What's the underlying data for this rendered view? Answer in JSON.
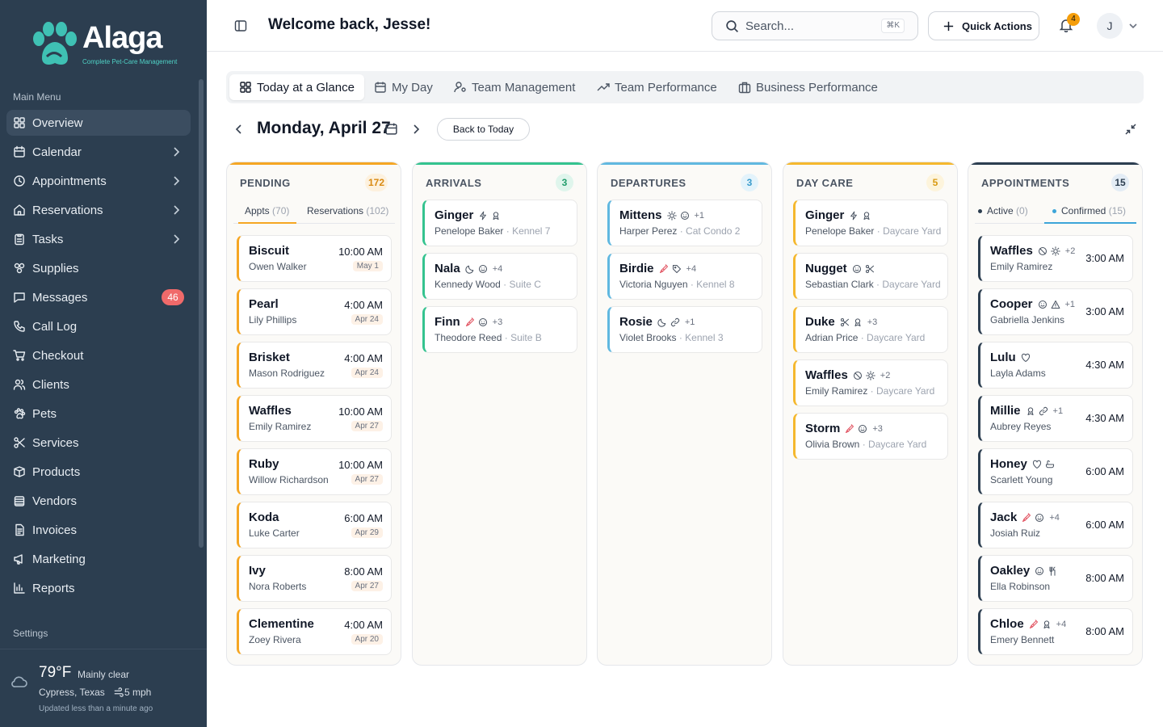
{
  "app": {
    "brand": "Alaga",
    "tagline": "Complete Pet-Care Management",
    "colors": {
      "sidebar": "#2c3e50",
      "pending": "#f5a623",
      "arrivals": "#34c38f",
      "departures": "#60b8e0",
      "daycare": "#f5b82e",
      "appointments": "#2c3e50",
      "badge": "#f06a6a"
    }
  },
  "sidebar": {
    "main_menu_label": "Main Menu",
    "settings_label": "Settings",
    "items": [
      {
        "label": "Overview",
        "icon": "grid-icon",
        "active": true
      },
      {
        "label": "Calendar",
        "icon": "calendar-icon",
        "chevron": true
      },
      {
        "label": "Appointments",
        "icon": "clock-icon",
        "chevron": true
      },
      {
        "label": "Reservations",
        "icon": "home-icon",
        "chevron": true
      },
      {
        "label": "Tasks",
        "icon": "clipboard-icon",
        "chevron": true
      },
      {
        "label": "Supplies",
        "icon": "boxes-icon"
      },
      {
        "label": "Messages",
        "icon": "message-icon",
        "badge": "46"
      },
      {
        "label": "Call Log",
        "icon": "phone-icon"
      },
      {
        "label": "Checkout",
        "icon": "cart-icon"
      },
      {
        "label": "Clients",
        "icon": "users-icon"
      },
      {
        "label": "Pets",
        "icon": "paw-icon"
      },
      {
        "label": "Services",
        "icon": "scissors-icon"
      },
      {
        "label": "Products",
        "icon": "package-icon"
      },
      {
        "label": "Vendors",
        "icon": "store-icon"
      },
      {
        "label": "Invoices",
        "icon": "invoice-icon"
      },
      {
        "label": "Marketing",
        "icon": "megaphone-icon"
      },
      {
        "label": "Reports",
        "icon": "bar-chart-icon"
      }
    ],
    "weather": {
      "temp": "79°F",
      "desc": "Mainly clear",
      "location": "Cypress, Texas",
      "wind": "5 mph",
      "updated": "Updated less than a minute ago"
    }
  },
  "header": {
    "welcome": "Welcome back, Jesse!",
    "search_placeholder": "Search...",
    "search_shortcut": "⌘K",
    "quick_actions": "Quick Actions",
    "notif_count": "4",
    "avatar_initial": "J"
  },
  "tabs": [
    {
      "label": "Today at a Glance",
      "icon": "grid-icon",
      "active": true
    },
    {
      "label": "My Day",
      "icon": "calendar-icon"
    },
    {
      "label": "Team Management",
      "icon": "user-cog-icon"
    },
    {
      "label": "Team Performance",
      "icon": "trending-up-icon"
    },
    {
      "label": "Business Performance",
      "icon": "briefcase-icon"
    }
  ],
  "date": {
    "title": "Monday, April 27",
    "back_to_today": "Back to Today"
  },
  "columns": {
    "pending": {
      "title": "PENDING",
      "count": "172",
      "subtabs": [
        {
          "label": "Appts",
          "count": "(70)",
          "active": true
        },
        {
          "label": "Reservations",
          "count": "(102)"
        }
      ],
      "cards": [
        {
          "name": "Biscuit",
          "owner": "Owen Walker",
          "time": "10:00 AM",
          "date": "May 1"
        },
        {
          "name": "Pearl",
          "owner": "Lily Phillips",
          "time": "4:00 AM",
          "date": "Apr 24"
        },
        {
          "name": "Brisket",
          "owner": "Mason Rodriguez",
          "time": "4:00 AM",
          "date": "Apr 24"
        },
        {
          "name": "Waffles",
          "owner": "Emily Ramirez",
          "time": "10:00 AM",
          "date": "Apr 27"
        },
        {
          "name": "Ruby",
          "owner": "Willow Richardson",
          "time": "10:00 AM",
          "date": "Apr 27"
        },
        {
          "name": "Koda",
          "owner": "Luke Carter",
          "time": "6:00 AM",
          "date": "Apr 29"
        },
        {
          "name": "Ivy",
          "owner": "Nora Roberts",
          "time": "8:00 AM",
          "date": "Apr 27"
        },
        {
          "name": "Clementine",
          "owner": "Zoey Rivera",
          "time": "4:00 AM",
          "date": "Apr 20"
        }
      ]
    },
    "arrivals": {
      "title": "ARRIVALS",
      "count": "3",
      "cards": [
        {
          "name": "Ginger",
          "icons": [
            "bolt-icon",
            "ribbon-icon"
          ],
          "more": "",
          "owner": "Penelope Baker",
          "location": "Kennel 7"
        },
        {
          "name": "Nala",
          "icons": [
            "moon-icon",
            "smile-icon"
          ],
          "more": "+4",
          "owner": "Kennedy Wood",
          "location": "Suite C"
        },
        {
          "name": "Finn",
          "icons": [
            "syringe-icon",
            "smile-icon"
          ],
          "more": "+3",
          "owner": "Theodore Reed",
          "location": "Suite B"
        }
      ]
    },
    "departures": {
      "title": "DEPARTURES",
      "count": "3",
      "cards": [
        {
          "name": "Mittens",
          "icons": [
            "sun-icon",
            "smile-icon"
          ],
          "more": "+1",
          "owner": "Harper Perez",
          "location": "Cat Condo 2"
        },
        {
          "name": "Birdie",
          "icons": [
            "syringe-icon",
            "tag-icon"
          ],
          "more": "+4",
          "owner": "Victoria Nguyen",
          "location": "Kennel 8"
        },
        {
          "name": "Rosie",
          "icons": [
            "moon-icon",
            "link-icon"
          ],
          "more": "+1",
          "owner": "Violet Brooks",
          "location": "Kennel 3"
        }
      ]
    },
    "daycare": {
      "title": "DAY CARE",
      "count": "5",
      "cards": [
        {
          "name": "Ginger",
          "icons": [
            "bolt-icon",
            "ribbon-icon"
          ],
          "more": "",
          "owner": "Penelope Baker",
          "location": "Daycare Yard"
        },
        {
          "name": "Nugget",
          "icons": [
            "smile-icon",
            "scissors-icon"
          ],
          "more": "",
          "owner": "Sebastian Clark",
          "location": "Daycare Yard"
        },
        {
          "name": "Duke",
          "icons": [
            "scissors-icon",
            "ribbon-icon"
          ],
          "more": "+3",
          "owner": "Adrian Price",
          "location": "Daycare Yard"
        },
        {
          "name": "Waffles",
          "icons": [
            "ban-icon",
            "sun-icon"
          ],
          "more": "+2",
          "owner": "Emily Ramirez",
          "location": "Daycare Yard"
        },
        {
          "name": "Storm",
          "icons": [
            "syringe-icon",
            "smile-icon"
          ],
          "more": "+3",
          "owner": "Olivia Brown",
          "location": "Daycare Yard"
        }
      ]
    },
    "appointments": {
      "title": "APPOINTMENTS",
      "count": "15",
      "subtabs": [
        {
          "label": "Active",
          "count": "(0)"
        },
        {
          "label": "Confirmed",
          "count": "(15)",
          "active": true
        }
      ],
      "cards": [
        {
          "name": "Waffles",
          "icons": [
            "ban-icon",
            "sun-icon"
          ],
          "more": "+2",
          "owner": "Emily Ramirez",
          "time": "3:00 AM"
        },
        {
          "name": "Cooper",
          "icons": [
            "smile-icon",
            "alert-icon"
          ],
          "more": "+1",
          "owner": "Gabriella Jenkins",
          "time": "3:00 AM"
        },
        {
          "name": "Lulu",
          "icons": [
            "heart-icon"
          ],
          "more": "",
          "owner": "Layla Adams",
          "time": "4:30 AM"
        },
        {
          "name": "Millie",
          "icons": [
            "ribbon-icon",
            "link-icon"
          ],
          "more": "+1",
          "owner": "Aubrey Reyes",
          "time": "4:30 AM"
        },
        {
          "name": "Honey",
          "icons": [
            "heart-icon",
            "bath-icon"
          ],
          "more": "",
          "owner": "Scarlett Young",
          "time": "6:00 AM"
        },
        {
          "name": "Jack",
          "icons": [
            "syringe-icon",
            "smile-icon"
          ],
          "more": "+4",
          "owner": "Josiah Ruiz",
          "time": "6:00 AM"
        },
        {
          "name": "Oakley",
          "icons": [
            "smile-icon",
            "utensils-icon"
          ],
          "more": "",
          "owner": "Ella Robinson",
          "time": "8:00 AM"
        },
        {
          "name": "Chloe",
          "icons": [
            "syringe-icon",
            "ribbon-icon"
          ],
          "more": "+4",
          "owner": "Emery Bennett",
          "time": "8:00 AM"
        }
      ]
    }
  }
}
